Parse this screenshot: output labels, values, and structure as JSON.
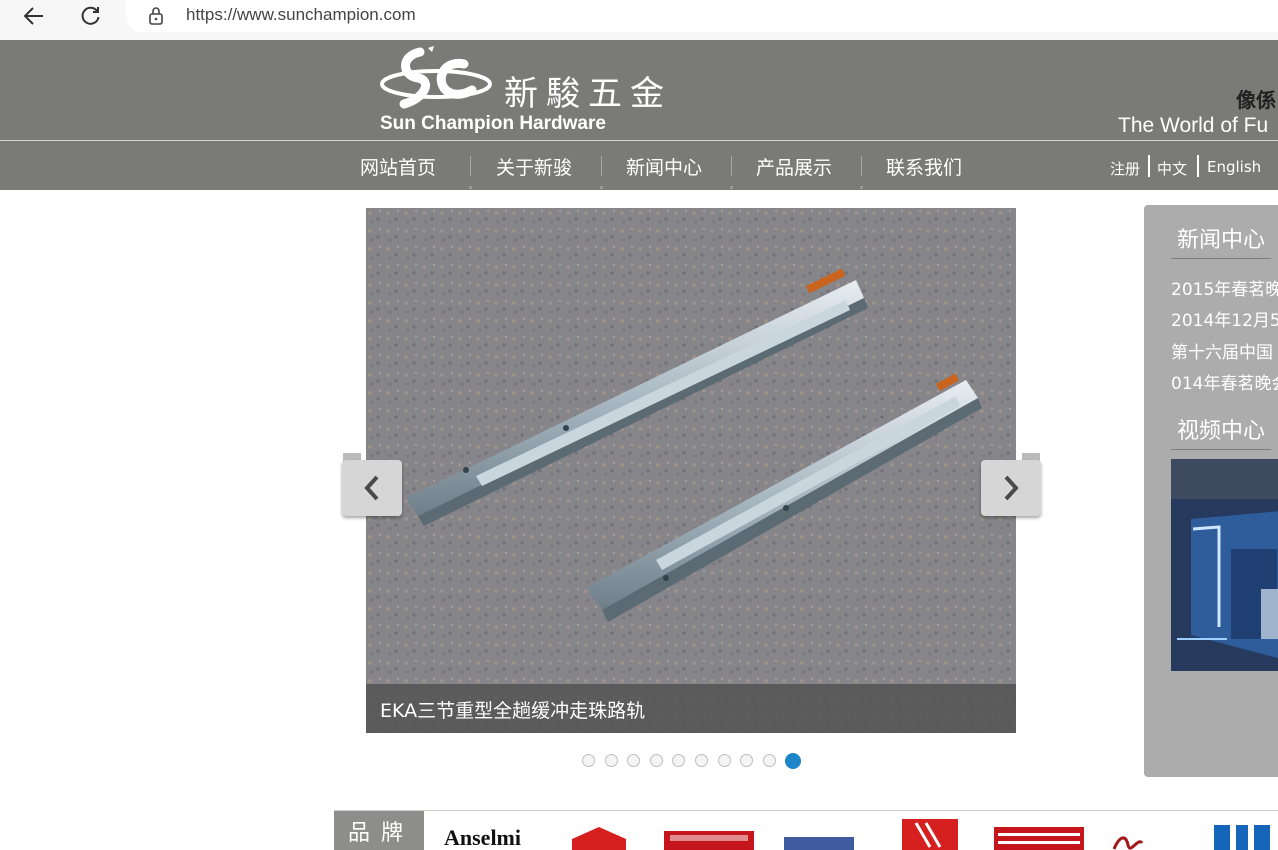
{
  "browser": {
    "url": "https://www.sunchampion.com"
  },
  "header": {
    "logo_cn": "新駿五金",
    "logo_en": "Sun Champion Hardware",
    "slogan_cn": "像係",
    "slogan_en": "The World of Fu"
  },
  "nav": {
    "items": [
      "网站首页",
      "关于新骏",
      "新闻中心",
      "产品展示",
      "联系我们"
    ],
    "util": [
      "注册",
      "中文",
      "English"
    ]
  },
  "slider": {
    "caption": "EKA三节重型全趟缓冲走珠路轨",
    "slide_count": 10,
    "active_slide": 10
  },
  "side": {
    "news_title": "新闻中心",
    "news": [
      "2015年春茗晚",
      "2014年12月5",
      "第十六届中国",
      "014年春茗晚会"
    ],
    "video_title": "视频中心"
  },
  "brands": {
    "label": "品 牌",
    "items": [
      "Anselmi"
    ]
  },
  "colors": {
    "header_bg": "#7a7a76",
    "panel_bg": "#acacac",
    "active_dot": "#1c86c8"
  }
}
